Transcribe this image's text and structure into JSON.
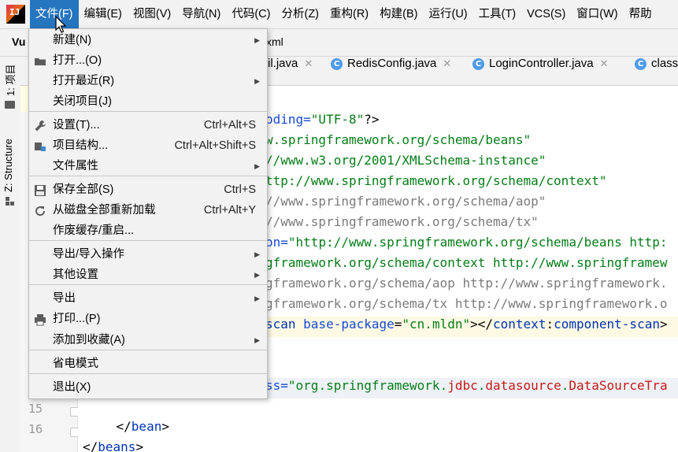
{
  "menubar": {
    "app_icon": "intellij-icon",
    "items": [
      {
        "label": "文件(F)",
        "active": true
      },
      {
        "label": "编辑(E)"
      },
      {
        "label": "视图(V)"
      },
      {
        "label": "导航(N)"
      },
      {
        "label": "代码(C)"
      },
      {
        "label": "分析(Z)"
      },
      {
        "label": "重构(R)"
      },
      {
        "label": "构建(B)"
      },
      {
        "label": "运行(U)"
      },
      {
        "label": "工具(T)"
      },
      {
        "label": "VCS(S)"
      },
      {
        "label": "窗口(W)"
      },
      {
        "label": "帮助"
      }
    ]
  },
  "breadcrumb": {
    "first": "Vu",
    "last": "xml"
  },
  "tabs": [
    {
      "label": "il.java",
      "close": "✕"
    },
    {
      "label": "RedisConfig.java",
      "icon_letter": "C",
      "close": "✕"
    },
    {
      "label": "LoginController.java",
      "icon_letter": "C",
      "close": "✕"
    },
    {
      "label": "class",
      "icon_letter": "C"
    }
  ],
  "side_panels": [
    {
      "label": "1: 项目"
    },
    {
      "label": "Z: Structure"
    }
  ],
  "file_menu": {
    "items": [
      {
        "label": "新建(N)",
        "submenu": true,
        "icon": ""
      },
      {
        "label": "打开...(O)",
        "icon": "folder-icon"
      },
      {
        "label": "打开最近(R)",
        "submenu": true
      },
      {
        "label": "关闭项目(J)"
      },
      {
        "label": "设置(T)...",
        "shortcut": "Ctrl+Alt+S",
        "icon": "wrench-icon"
      },
      {
        "label": "项目结构...",
        "shortcut": "Ctrl+Alt+Shift+S",
        "icon": "project-structure-icon"
      },
      {
        "label": "文件属性",
        "submenu": true
      },
      {
        "label": "保存全部(S)",
        "shortcut": "Ctrl+S",
        "icon": "save-icon"
      },
      {
        "label": "从磁盘全部重新加载",
        "shortcut": "Ctrl+Alt+Y",
        "icon": "reload-icon"
      },
      {
        "label": "作废缓存/重启..."
      },
      {
        "label": "导出/导入操作",
        "submenu": true
      },
      {
        "label": "其他设置",
        "submenu": true
      },
      {
        "label": "导出",
        "submenu": true
      },
      {
        "label": "打印...(P)",
        "icon": "print-icon"
      },
      {
        "label": "添加到收藏(A)",
        "submenu": true
      },
      {
        "label": "省电模式"
      },
      {
        "label": "退出(X)"
      }
    ]
  },
  "editor": {
    "line_numbers": [
      "15",
      "16"
    ],
    "lines": [
      {
        "segments": [
          {
            "t": "oding=",
            "c": "attr"
          },
          {
            "t": "\"UTF-8\"",
            "c": "str"
          },
          {
            "t": "?>",
            "c": "plain"
          }
        ]
      },
      {
        "segments": [
          {
            "t": "w.springframework.org/schema/beans\"",
            "c": "str"
          }
        ]
      },
      {
        "segments": [
          {
            "t": "//www.w3.org/2001/XMLSchema-instance\"",
            "c": "str"
          }
        ]
      },
      {
        "segments": [
          {
            "t": "ttp://www.springframework.org/schema/context\"",
            "c": "str"
          }
        ]
      },
      {
        "segments": [
          {
            "t": "//www.springframework.org/schema/aop\"",
            "c": "strgray"
          }
        ]
      },
      {
        "segments": [
          {
            "t": "//www.springframework.org/schema/tx\"",
            "c": "strgray"
          }
        ]
      },
      {
        "segments": [
          {
            "t": "on=",
            "c": "attr"
          },
          {
            "t": "\"http://www.springframework.org/schema/beans http:",
            "c": "str"
          }
        ]
      },
      {
        "segments": [
          {
            "t": "gframework.org/schema/context http://www.springframew",
            "c": "str"
          }
        ]
      },
      {
        "segments": [
          {
            "t": "gframework.org/schema/aop http://www.springframework.",
            "c": "strgray"
          }
        ]
      },
      {
        "segments": [
          {
            "t": "gframework.org/schema/tx http://www.springframework.o",
            "c": "strgray"
          }
        ]
      },
      {
        "segments": [
          {
            "t": "scan ",
            "c": "tag"
          },
          {
            "t": "base-package",
            "c": "attr"
          },
          {
            "t": "=",
            "c": "plain"
          },
          {
            "t": "\"cn.mldn\"",
            "c": "str"
          },
          {
            "t": "></",
            "c": "plain"
          },
          {
            "t": "context",
            "c": "tag"
          },
          {
            "t": ":",
            "c": "plain"
          },
          {
            "t": "component-scan",
            "c": "tag"
          },
          {
            "t": ">",
            "c": "plain"
          }
        ]
      },
      {
        "segments": []
      },
      {
        "segments": []
      },
      {
        "segments": [
          {
            "t": "ss=",
            "c": "attr"
          },
          {
            "t": "\"org.springframework.",
            "c": "str"
          },
          {
            "t": "jdbc",
            "c": "red"
          },
          {
            "t": ".",
            "c": "str"
          },
          {
            "t": "datasource",
            "c": "red"
          },
          {
            "t": ".",
            "c": "str"
          },
          {
            "t": "DataSourceTra",
            "c": "red"
          }
        ]
      },
      {
        "segments": []
      },
      {
        "segments": [
          {
            "t": "    </",
            "c": "plain"
          },
          {
            "t": "bean",
            "c": "tag"
          },
          {
            "t": ">",
            "c": "plain"
          }
        ]
      },
      {
        "segments": [
          {
            "t": "</",
            "c": "plain"
          },
          {
            "t": "beans",
            "c": "tag"
          },
          {
            "t": ">",
            "c": "plain"
          }
        ]
      }
    ]
  }
}
